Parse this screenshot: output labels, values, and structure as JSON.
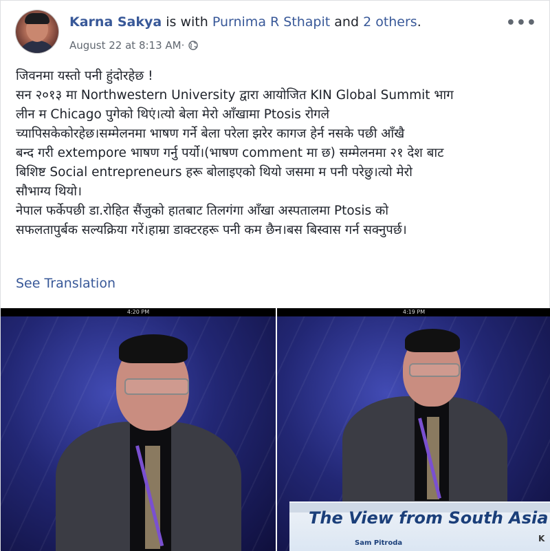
{
  "post": {
    "author": "Karna Sakya",
    "with_text": " is with ",
    "tagged_person": "Purnima R Sthapit",
    "and_text": " and ",
    "others": "2 others",
    "period": ".",
    "timestamp": "August 22 at 8:13 AM",
    "separator": " · ",
    "privacy_icon": "globe-icon",
    "more_icon": "more-options-icon",
    "more_glyph": "•••",
    "text_lines": [
      "जिवनमा यस्तो पनी हुंदोरहेछ !",
      "सन २०१३ मा Northwestern University द्वारा आयोजित KIN Global Summit भाग",
      "लीन म Chicago पुगेको थिएं।त्यो बेला मेरो आँखामा Ptosis रोगले",
      "च्यापिसकेकोरहेछ।सम्मेलनमा भाषण गर्ने बेला परेला झरेर कागज हेर्न नसके पछी आँखै",
      "बन्द गरी extempore भाषण गर्नु पर्यो।(भाषण comment मा छ) सम्मेलनमा २१ देश बाट",
      "बिशिष्ट Social entrepreneurs हरू बोलाइएको थियो जसमा म पनी परेछु।त्यो मेरो",
      "सौभाग्य थियो।",
      "नेपाल फर्केपछी डा.रोहित सैंजुको हातबाट तिलगंगा आँखा अस्पतालमा Ptosis को",
      "सफलतापुर्बक सल्यक्रिया गरें।हाम्रा डाक्टरहरू पनी कम छैन।बस बिस्वास गर्न सक्नुपर्छ।"
    ],
    "see_translation": "See Translation"
  },
  "photos": {
    "left_timestamp": "4:20 PM",
    "right_timestamp": "4:19 PM",
    "banner_title": "The View from South Asia",
    "banner_subtitle": "Sam Pitroda",
    "banner_corner": "K"
  },
  "colors": {
    "link": "#385898",
    "text": "#1d2129",
    "meta": "#606770"
  }
}
